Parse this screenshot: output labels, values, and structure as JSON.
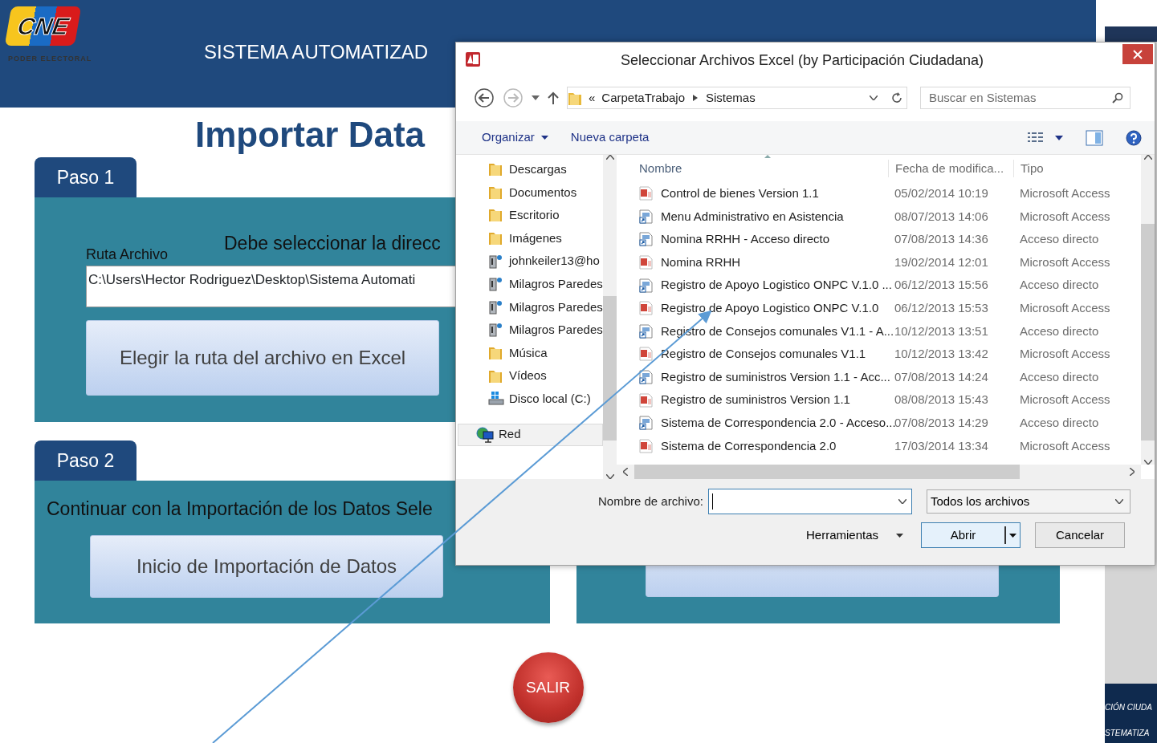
{
  "app": {
    "logo": {
      "mark": "CNE",
      "caption": "PODER ELECTORAL"
    },
    "header_title": "SISTEMA AUTOMATIZAD",
    "page_title": "Importar Data",
    "step1": {
      "tab": "Paso 1",
      "message": "Debe seleccionar la direcc",
      "field_label": "Ruta Archivo",
      "field_value": "C:\\Users\\Hector Rodriguez\\Desktop\\Sistema Automati",
      "button": "Elegir la ruta del archivo en Excel"
    },
    "step2": {
      "tab": "Paso 2",
      "message": "Continuar con la Importación de los Datos Sele",
      "button": "Inicio de Importación de Datos"
    },
    "exit_button": "SALIR"
  },
  "side_window": {
    "lines": [
      "CIÓN CIUDA",
      "STEMATIZA"
    ]
  },
  "dialog": {
    "title": "Seleccionar Archivos Excel (by Participación Ciudadana)",
    "address": {
      "overflow": "«",
      "segments": [
        "CarpetaTrabajo",
        "Sistemas"
      ]
    },
    "search": {
      "placeholder": "Buscar en Sistemas"
    },
    "commands": [
      "Organizar",
      "Nueva carpeta"
    ],
    "nav_items": [
      {
        "label": "Descargas",
        "kind": "folder",
        "selected": false
      },
      {
        "label": "Documentos",
        "kind": "folder",
        "selected": false
      },
      {
        "label": "Escritorio",
        "kind": "folder",
        "selected": false
      },
      {
        "label": "Imágenes",
        "kind": "folder",
        "selected": false
      },
      {
        "label": "johnkeiler13@ho",
        "kind": "user",
        "selected": false
      },
      {
        "label": "Milagros Paredes",
        "kind": "user",
        "selected": false
      },
      {
        "label": "Milagros Paredes",
        "kind": "user",
        "selected": false
      },
      {
        "label": "Milagros Paredes",
        "kind": "user",
        "selected": false
      },
      {
        "label": "Música",
        "kind": "folder",
        "selected": false
      },
      {
        "label": "Vídeos",
        "kind": "folder",
        "selected": false
      },
      {
        "label": "Disco local (C:)",
        "kind": "drive",
        "selected": false
      },
      {
        "label": "Red",
        "kind": "network",
        "selected": true
      }
    ],
    "columns": [
      "Nombre",
      "Fecha de modifica...",
      "Tipo"
    ],
    "files": [
      {
        "name": "Control de bienes Version 1.1",
        "date": "05/02/2014 10:19",
        "type": "Microsoft Access",
        "kind": "access"
      },
      {
        "name": "Menu Administrativo en Asistencia",
        "date": "08/07/2013 14:06",
        "type": "Microsoft Access",
        "kind": "shortcut"
      },
      {
        "name": "Nomina RRHH - Acceso directo",
        "date": "07/08/2013 14:36",
        "type": "Acceso directo",
        "kind": "shortcut"
      },
      {
        "name": "Nomina RRHH",
        "date": "19/02/2014 12:01",
        "type": "Microsoft Access",
        "kind": "access"
      },
      {
        "name": "Registro de Apoyo Logistico ONPC V.1.0 ...",
        "date": "06/12/2013 15:56",
        "type": "Acceso directo",
        "kind": "shortcut"
      },
      {
        "name": "Registro de Apoyo Logistico ONPC V.1.0",
        "date": "06/12/2013 15:53",
        "type": "Microsoft Access",
        "kind": "access"
      },
      {
        "name": "Registro de Consejos comunales V1.1 - A...",
        "date": "10/12/2013 13:51",
        "type": "Acceso directo",
        "kind": "shortcut"
      },
      {
        "name": "Registro de Consejos comunales V1.1",
        "date": "10/12/2013 13:42",
        "type": "Microsoft Access",
        "kind": "access"
      },
      {
        "name": "Registro de suministros Version 1.1 - Acc...",
        "date": "07/08/2013 14:24",
        "type": "Acceso directo",
        "kind": "shortcut"
      },
      {
        "name": "Registro de suministros Version 1.1",
        "date": "08/08/2013 15:43",
        "type": "Microsoft Access",
        "kind": "access"
      },
      {
        "name": "Sistema de Correspondencia 2.0 - Acceso...",
        "date": "07/08/2013 14:29",
        "type": "Acceso directo",
        "kind": "shortcut"
      },
      {
        "name": "Sistema de Correspondencia 2.0",
        "date": "17/03/2014 13:34",
        "type": "Microsoft Access",
        "kind": "access"
      }
    ],
    "filename_label": "Nombre de archivo:",
    "filter": "Todos los archivos",
    "tools": "Herramientas",
    "open_button": "Abrir",
    "cancel_button": "Cancelar"
  }
}
